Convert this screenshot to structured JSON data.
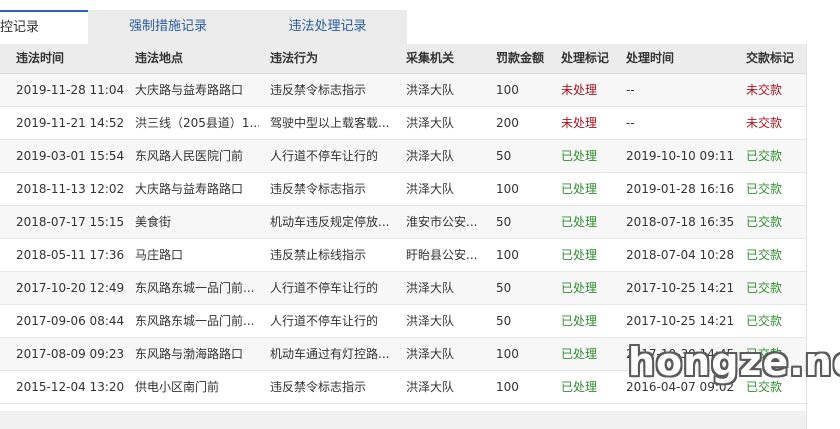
{
  "tabs": [
    {
      "label": "监控记录"
    },
    {
      "label": "强制措施记录"
    },
    {
      "label": "违法处理记录"
    }
  ],
  "table": {
    "headers": {
      "time": "违法时间",
      "place": "违法地点",
      "act": "违法行为",
      "org": "采集机关",
      "fine": "罚款金额",
      "status": "处理标记",
      "ptime": "处理时间",
      "pay": "交款标记"
    },
    "rows": [
      {
        "time": "2019-11-28 11:04",
        "place": "大庆路与益寿路路口",
        "act": "违反禁令标志指示",
        "org": "洪泽大队",
        "fine": "100",
        "status": "未处理",
        "ptime": "--",
        "pay": "未交款"
      },
      {
        "time": "2019-11-21 14:52",
        "place": "洪三线（205县道）1...",
        "act": "驾驶中型以上载客载...",
        "org": "洪泽大队",
        "fine": "200",
        "status": "未处理",
        "ptime": "--",
        "pay": "未交款"
      },
      {
        "time": "2019-03-01 15:54",
        "place": "东风路人民医院门前",
        "act": "人行道不停车让行的",
        "org": "洪泽大队",
        "fine": "50",
        "status": "已处理",
        "ptime": "2019-10-10 09:11",
        "pay": "已交款"
      },
      {
        "time": "2018-11-13 12:02",
        "place": "大庆路与益寿路路口",
        "act": "违反禁令标志指示",
        "org": "洪泽大队",
        "fine": "100",
        "status": "已处理",
        "ptime": "2019-01-28 16:16",
        "pay": "已交款"
      },
      {
        "time": "2018-07-17 15:15",
        "place": "美食街",
        "act": "机动车违反规定停放...",
        "org": "淮安市公安...",
        "fine": "50",
        "status": "已处理",
        "ptime": "2018-07-18 16:35",
        "pay": "已交款"
      },
      {
        "time": "2018-05-11 17:36",
        "place": "马庄路口",
        "act": "违反禁止标线指示",
        "org": "盱眙县公安...",
        "fine": "100",
        "status": "已处理",
        "ptime": "2018-07-04 10:28",
        "pay": "已交款"
      },
      {
        "time": "2017-10-20 12:49",
        "place": "东风路东城一品门前...",
        "act": "人行道不停车让行的",
        "org": "洪泽大队",
        "fine": "50",
        "status": "已处理",
        "ptime": "2017-10-25 14:21",
        "pay": "已交款"
      },
      {
        "time": "2017-09-06 08:44",
        "place": "东风路东城一品门前...",
        "act": "人行道不停车让行的",
        "org": "洪泽大队",
        "fine": "50",
        "status": "已处理",
        "ptime": "2017-10-25 14:21",
        "pay": "已交款"
      },
      {
        "time": "2017-08-09 09:23",
        "place": "东风路与渤海路路口",
        "act": "机动车通过有灯控路...",
        "org": "洪泽大队",
        "fine": "100",
        "status": "已处理",
        "ptime": "2017-10-30 14:45",
        "pay": "已交款"
      },
      {
        "time": "2015-12-04 13:20",
        "place": "供电小区南门前",
        "act": "违反禁令标志指示",
        "org": "洪泽大队",
        "fine": "100",
        "status": "已处理",
        "ptime": "2016-04-07 09:02",
        "pay": "已交款"
      }
    ]
  },
  "watermark": "hongze.net",
  "colors": {
    "unpaid_red": "#a8141e",
    "paid_green": "#2f8f2f",
    "tab_accent": "#2a63b8",
    "tab_text": "#2a5d9f"
  }
}
